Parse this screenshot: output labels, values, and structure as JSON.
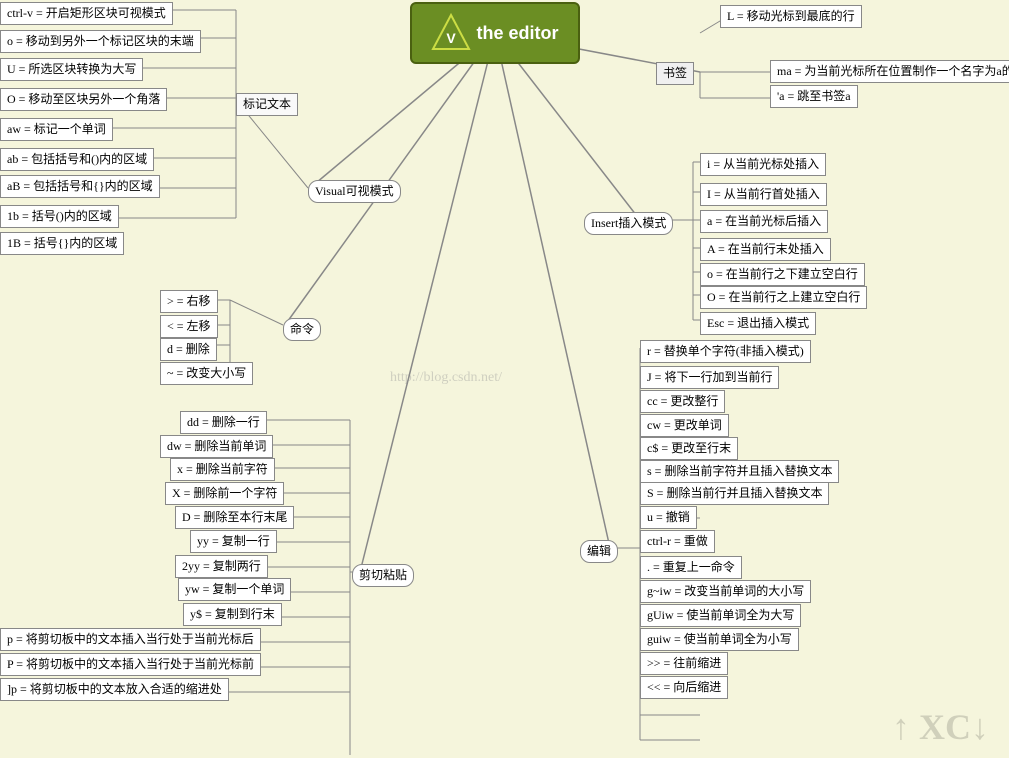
{
  "title": "the editor",
  "watermark": "http://blog.csdn.net/",
  "watermark_bottom": "↑ XC↓",
  "visual_mode": {
    "label": "Visual可视模式",
    "items": [
      "ctrl-v = 开启矩形区块可视模式",
      "o = 移动到另外一个标记区块的末端",
      "U = 所选区块转换为大写",
      "O = 移动至区块另外一个角落",
      "aw = 标记一个单词",
      "ab = 包括括号和()内的区域",
      "aB = 包括括号和{}内的区域",
      "1b = 括号()内的区域",
      "1B = 括号{}内的区域"
    ],
    "label2": "标记文本"
  },
  "command_mode": {
    "label": "命令",
    "items": [
      "> = 右移",
      "< = 左移",
      "d = 删除",
      "~ = 改变大小写"
    ]
  },
  "insert_mode": {
    "label": "Insert插入模式",
    "items": [
      "i = 从当前光标处插入",
      "I = 从当前行首处插入",
      "a = 在当前光标后插入",
      "A = 在当前行末处插入",
      "o = 在当前行之下建立空白行",
      "O = 在当前行之上建立空白行",
      "Esc = 退出插入模式"
    ]
  },
  "edit_mode": {
    "label": "编辑",
    "items": [
      "r = 替换单个字符(非插入模式)",
      "J = 将下一行加到当前行",
      "cc = 更改整行",
      "cw = 更改单词",
      "c$ = 更改至行末",
      "s = 删除当前字符并且插入替换文本",
      "S = 删除当前行并且插入替换文本",
      "u = 撤销",
      "ctrl-r = 重做",
      ". = 重复上一命令",
      "g~iw = 改变当前单词的大小写",
      "gUiw = 使当前单词全为大写",
      "guiw = 使当前单词全为小写",
      ">> = 往前缩进",
      "<< = 向后缩进"
    ]
  },
  "cut_paste": {
    "label": "剪切粘贴",
    "items": [
      "dd = 删除一行",
      "dw = 删除当前单词",
      "x = 删除当前字符",
      "X = 删除前一个字符",
      "D = 删除至本行末尾",
      "yy = 复制一行",
      "2yy = 复制两行",
      "yw = 复制一个单词",
      "y$ = 复制到行末",
      "p = 将剪切板中的文本插入当行处于当前光标后",
      "P = 将剪切板中的文本插入当行处于当前光标前",
      "]p = 将剪切板中的文本放入合适的缩进处"
    ]
  },
  "bookmark": {
    "label": "书签",
    "items": [
      "ma = 为当前光标所在位置制作一个名字为a的书签",
      "'a = 跳至书签a"
    ]
  },
  "move": {
    "label": "L = 移动光标到最底的行"
  }
}
